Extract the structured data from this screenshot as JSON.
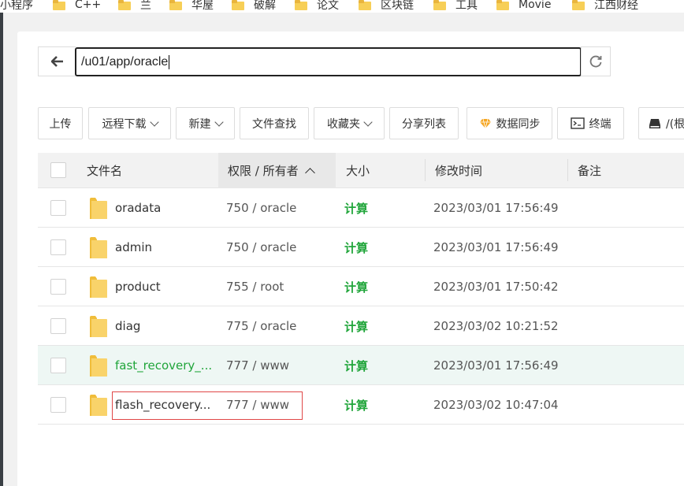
{
  "bookmarks": [
    {
      "label": "小程序",
      "folder": false
    },
    {
      "label": "C++",
      "folder": true
    },
    {
      "label": "兰",
      "folder": true
    },
    {
      "label": "华屋",
      "folder": true
    },
    {
      "label": "破解",
      "folder": true
    },
    {
      "label": "论文",
      "folder": true
    },
    {
      "label": "区块链",
      "folder": true
    },
    {
      "label": "工具",
      "folder": true
    },
    {
      "label": "Movie",
      "folder": true
    },
    {
      "label": "江西财经",
      "folder": true
    }
  ],
  "path": {
    "value": "/u01/app/oracle"
  },
  "toolbar": {
    "upload": "上传",
    "remote_download": "远程下载",
    "new": "新建",
    "file_search": "文件查找",
    "favorites": "收藏夹",
    "share_list": "分享列表",
    "data_sync": "数据同步",
    "terminal": "终端",
    "root": "/(根"
  },
  "table": {
    "headers": {
      "name": "文件名",
      "perm": "权限 / 所有者",
      "size": "大小",
      "mtime": "修改时间",
      "note": "备注"
    },
    "rows": [
      {
        "name": "oradata",
        "perm": "750 / oracle",
        "size": "计算",
        "mtime": "2023/03/01 17:56:49"
      },
      {
        "name": "admin",
        "perm": "750 / oracle",
        "size": "计算",
        "mtime": "2023/03/01 17:56:49"
      },
      {
        "name": "product",
        "perm": "755 / root",
        "size": "计算",
        "mtime": "2023/03/01 17:50:42"
      },
      {
        "name": "diag",
        "perm": "775 / oracle",
        "size": "计算",
        "mtime": "2023/03/02 10:21:52"
      },
      {
        "name": "fast_recovery_...",
        "perm": "777 / www",
        "size": "计算",
        "mtime": "2023/03/01 17:56:49"
      },
      {
        "name": "flash_recovery...",
        "perm": "777 / www",
        "size": "计算",
        "mtime": "2023/03/02 10:47:04"
      }
    ]
  },
  "colors": {
    "accent_green": "#20a53a",
    "folder_yellow": "#f7cf57",
    "highlight_red": "#e04747",
    "hover_row": "#eef7f4"
  }
}
